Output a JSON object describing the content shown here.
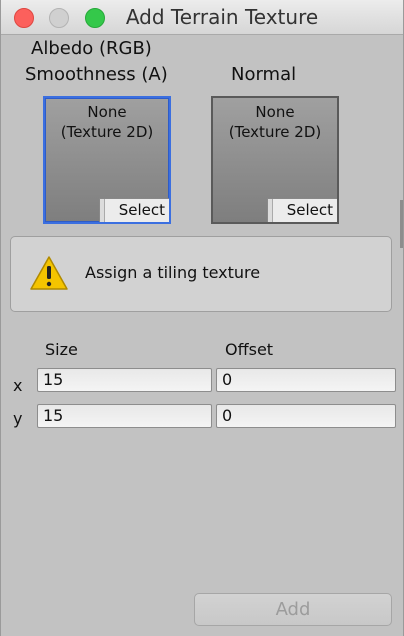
{
  "window": {
    "title": "Add Terrain Texture"
  },
  "albedo": {
    "label_line1": "Albedo (RGB)",
    "label_line2": "Smoothness (A)",
    "value_line1": "None",
    "value_line2": "(Texture 2D)",
    "select_label": "Select"
  },
  "normal": {
    "label": "Normal",
    "value_line1": "None",
    "value_line2": "(Texture 2D)",
    "select_label": "Select"
  },
  "warning": {
    "icon": "warning-triangle-icon",
    "text": "Assign a tiling texture"
  },
  "tiling": {
    "size_label": "Size",
    "offset_label": "Offset",
    "x_label": "x",
    "y_label": "y",
    "size_x": "15",
    "size_y": "15",
    "offset_x": "0",
    "offset_y": "0"
  },
  "actions": {
    "add_label": "Add"
  },
  "colors": {
    "selected_slot_border": "#3b6fe0",
    "warning_yellow": "#f4c400",
    "close": "#fc605c",
    "maximize": "#34c84a"
  }
}
